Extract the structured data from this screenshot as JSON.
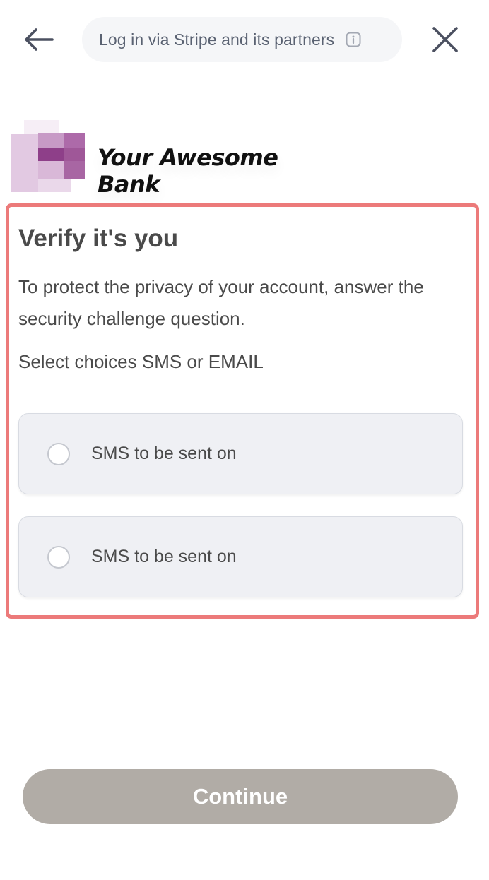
{
  "header": {
    "stripe_pill_text": "Log in via Stripe and its partners",
    "back_icon": "arrow-left-icon",
    "close_icon": "close-icon",
    "info_icon": "info-icon"
  },
  "bank": {
    "name": "Your Awesome Bank"
  },
  "challenge": {
    "title": "Verify it's you",
    "description": "To protect the privacy of your account, answer the security challenge question.",
    "select_prompt": "Select choices SMS or EMAIL",
    "options": [
      {
        "label": "SMS to be sent on",
        "selected": false
      },
      {
        "label": "SMS to be sent on",
        "selected": false
      }
    ]
  },
  "footer": {
    "continue_label": "Continue"
  },
  "colors": {
    "highlight_border": "#ec7a7a",
    "continue_disabled": "#b1aca6",
    "option_bg": "#eff0f4",
    "pill_bg": "#f5f6f8"
  }
}
